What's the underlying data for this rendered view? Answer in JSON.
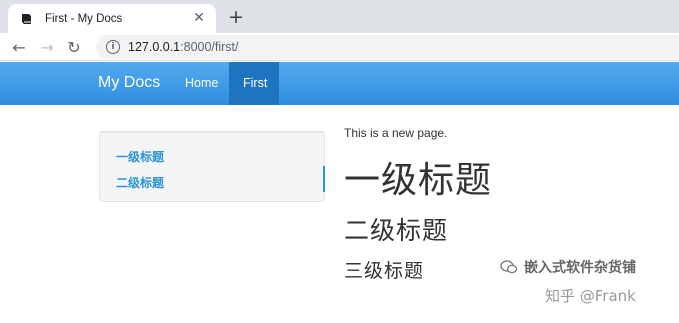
{
  "browser": {
    "tab": {
      "title": "First - My Docs",
      "favicon": "book-icon",
      "close_glyph": "✕"
    },
    "new_tab_glyph": "+",
    "toolbar": {
      "back_glyph": "←",
      "forward_glyph": "→",
      "reload_glyph": "↻",
      "info_glyph": "i"
    },
    "address": {
      "host": "127.0.0.1",
      "path": ":8000/first/"
    }
  },
  "site": {
    "brand": "My Docs",
    "nav": [
      {
        "label": "Home",
        "active": false
      },
      {
        "label": "First",
        "active": true
      }
    ],
    "accent": "#2a94d6"
  },
  "toc": {
    "items": [
      "一级标题",
      "二级标题"
    ]
  },
  "content": {
    "intro": "This is a new page.",
    "h1": "一级标题",
    "h2": "二级标题",
    "h3": "三级标题"
  },
  "watermark": {
    "line1": "嵌入式软件杂货铺",
    "line2": "知乎 @Frank",
    "icon": "wechat-icon"
  }
}
